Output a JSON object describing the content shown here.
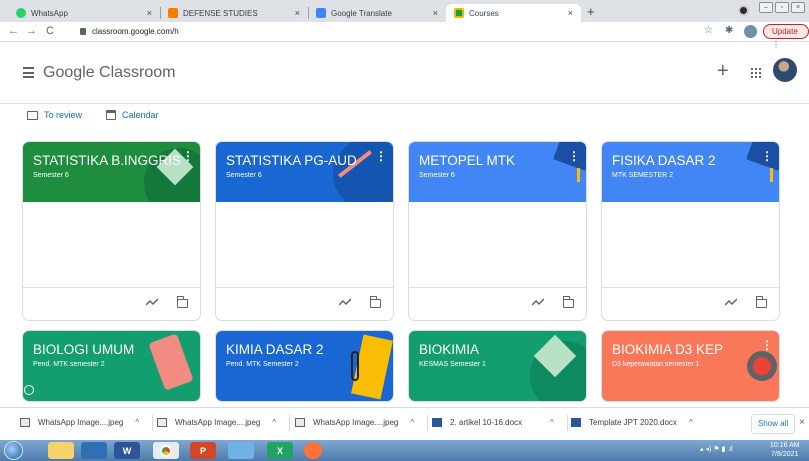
{
  "browser": {
    "tabs": [
      {
        "label": "WhatsApp",
        "icon": "whatsapp-icon",
        "color": "#25d366",
        "active": false
      },
      {
        "label": "DEFENSE STUDIES",
        "icon": "blogger-icon",
        "color": "#f57d00",
        "active": false
      },
      {
        "label": "Google Translate",
        "icon": "translate-icon",
        "color": "#4285f4",
        "active": false
      },
      {
        "label": "Courses",
        "icon": "classroom-icon",
        "color": "#0f9d58",
        "active": true
      }
    ],
    "close_glyph": "×",
    "new_tab_glyph": "+",
    "url": "classroom.google.com/h",
    "update_label": "Update",
    "update_dots": "⋮"
  },
  "app": {
    "brand_google": "Google",
    "brand_classroom": " Classroom",
    "to_review": "To review",
    "calendar": "Calendar"
  },
  "courses": [
    {
      "title": "STATISTIKA B.INGGRIS",
      "subtitle": "Semester 6",
      "color": "#1e8e3e"
    },
    {
      "title": "STATISTIKA PG-AUD",
      "subtitle": "Semester 6",
      "color": "#1967d2"
    },
    {
      "title": "METOPEL MTK",
      "subtitle": "Semester 6",
      "color": "#4285f4"
    },
    {
      "title": "FISIKA DASAR 2",
      "subtitle": "MTK SEMESTER 2",
      "color": "#4285f4"
    },
    {
      "title": "BIOLOGI UMUM",
      "subtitle": "Pend. MTK semester 2",
      "color": "#129e6e"
    },
    {
      "title": "KIMIA DASAR 2",
      "subtitle": "Pend. MTK Semester 2",
      "color": "#1967d2"
    },
    {
      "title": "BIOKIMIA",
      "subtitle": "KESMAS Semester 1",
      "color": "#129e6e"
    },
    {
      "title": "BIOKIMIA D3 KEP",
      "subtitle": "D3 keperawatan semester 1",
      "color": "#f9785a"
    }
  ],
  "downloads": {
    "items": [
      {
        "name": "WhatsApp Image....jpeg",
        "type": "image"
      },
      {
        "name": "WhatsApp Image....jpeg",
        "type": "image"
      },
      {
        "name": "WhatsApp Image....jpeg",
        "type": "image"
      },
      {
        "name": "2. artikel 10-16.docx",
        "type": "word"
      },
      {
        "name": "Template JPT 2020.docx",
        "type": "word"
      }
    ],
    "caret": "^",
    "show_all": "Show all",
    "close": "×"
  },
  "taskbar": {
    "time": "10:16 AM",
    "date": "7/8/2021"
  }
}
